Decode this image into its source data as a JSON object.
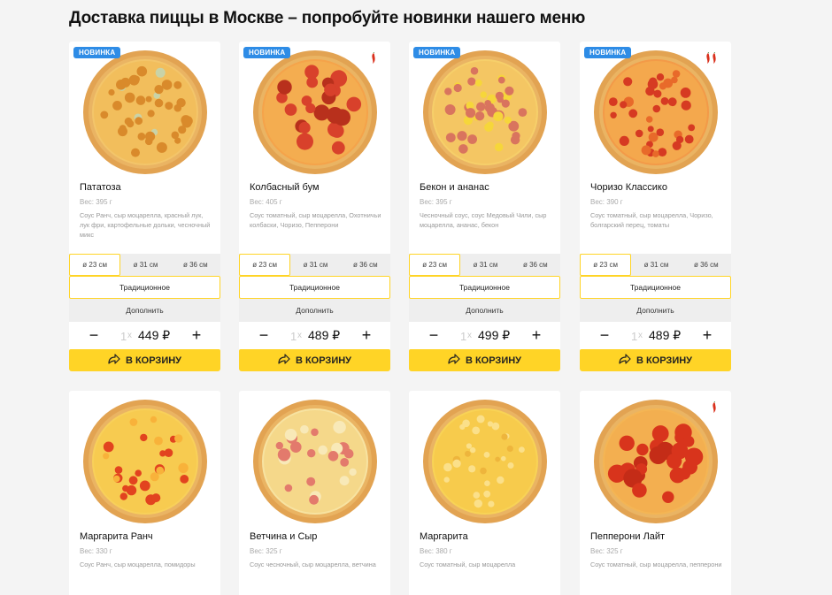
{
  "heading": "Доставка пиццы в Москве – попробуйте новинки нашего меню",
  "labels": {
    "badge": "НОВИНКА",
    "dough": "Традиционное",
    "addon": "Дополнить",
    "cart": "В КОРЗИНУ",
    "qty": "1",
    "times": "x",
    "minus": "−",
    "plus": "+",
    "sizes": [
      "ø 23 см",
      "ø 31 см",
      "ø 36 см"
    ]
  },
  "icons": {
    "chili": "chili-pepper-icon",
    "cart": "cart-arrow-icon"
  },
  "colors": {
    "accent": "#ffd426",
    "badge": "#2e8ce6",
    "chili": "#d9301c"
  },
  "products": [
    {
      "name": "Пататоза",
      "weight": "Вес: 395 г",
      "desc": "Соус Ранч, сыр моцарелла, красный лук, лук фри, картофельные дольки, чесночный микс",
      "price": "449 ₽",
      "is_new": true,
      "chili_count": 0,
      "topping": "potato",
      "active_size": 0
    },
    {
      "name": "Колбасный бум",
      "weight": "Вес: 405 г",
      "desc": "Соус томатный, сыр моцарелла, Охотничьи колбаски, Чоризо, Пепперони",
      "price": "489 ₽",
      "is_new": true,
      "chili_count": 1,
      "topping": "sausage",
      "active_size": 0
    },
    {
      "name": "Бекон и ананас",
      "weight": "Вес: 395 г",
      "desc": "Чесночный соус, соус Медовый Чили, сыр моцарелла, ананас, бекон",
      "price": "499 ₽",
      "is_new": true,
      "chili_count": 0,
      "topping": "bacon",
      "active_size": 0
    },
    {
      "name": "Чоризо Классико",
      "weight": "Вес: 390 г",
      "desc": "Соус томатный, сыр моцарелла, Чоризо, болгарский перец, томаты",
      "price": "489 ₽",
      "is_new": true,
      "chili_count": 2,
      "topping": "chorizo",
      "active_size": 0
    },
    {
      "name": "Маргарита Ранч",
      "weight": "Вес: 330 г",
      "desc": "Соус Ранч, сыр моцарелла, помидоры",
      "is_new": false,
      "chili_count": 0,
      "topping": "tomato"
    },
    {
      "name": "Ветчина и Сыр",
      "weight": "Вес: 325 г",
      "desc": "Соус чесночный, сыр моцарелла, ветчина",
      "is_new": false,
      "chili_count": 0,
      "topping": "ham"
    },
    {
      "name": "Маргарита",
      "weight": "Вес: 380 г",
      "desc": "Соус томатный, сыр моцарелла",
      "is_new": false,
      "chili_count": 0,
      "topping": "cheese"
    },
    {
      "name": "Пепперони Лайт",
      "weight": "Вес: 325 г",
      "desc": "Соус томатный, сыр моцарелла, пепперони",
      "is_new": false,
      "chili_count": 1,
      "topping": "pepperoni"
    }
  ]
}
